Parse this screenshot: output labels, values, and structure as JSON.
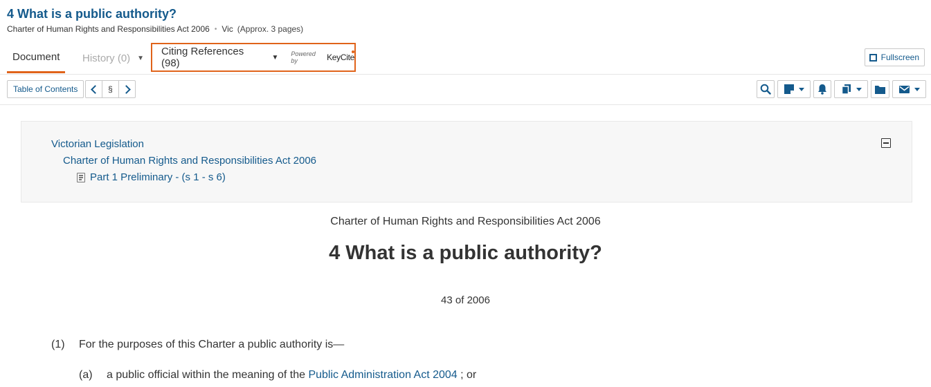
{
  "header": {
    "title": "4 What is a public authority?",
    "act": "Charter of Human Rights and Responsibilities Act 2006",
    "separator": "•",
    "jurisdiction": "Vic",
    "pages": "(Approx. 3 pages)"
  },
  "tabs": {
    "document": "Document",
    "history": "History (0)",
    "citing": "Citing References (98)",
    "powered_by": "Powered by",
    "keycite": "KeyCite"
  },
  "toolbar": {
    "fullscreen": "Fullscreen",
    "toc": "Table of Contents",
    "section_symbol": "§"
  },
  "breadcrumb": {
    "level1": "Victorian Legislation",
    "level2": "Charter of Human Rights and Responsibilities Act 2006",
    "level3": "Part 1 Preliminary - (s 1 - s 6)"
  },
  "document": {
    "act_name": "Charter of Human Rights and Responsibilities Act 2006",
    "section_title": "4 What is a public authority?",
    "act_number": "43 of 2006",
    "clause1_num": "(1)",
    "clause1_text": "For the purposes of this Charter a public authority is—",
    "clause_a_num": "(a)",
    "clause_a_pre": "a public official within the meaning of the",
    "clause_a_link": "Public Administration Act 2004",
    "clause_a_post": "; or"
  },
  "colors": {
    "link": "#145a8c",
    "accent": "#e0631a"
  },
  "icons": [
    "fullscreen-icon",
    "chevron-left-icon",
    "chevron-right-icon",
    "search-icon",
    "note-icon",
    "bell-icon",
    "copy-icon",
    "folder-icon",
    "mail-icon",
    "document-icon",
    "collapse-icon"
  ]
}
